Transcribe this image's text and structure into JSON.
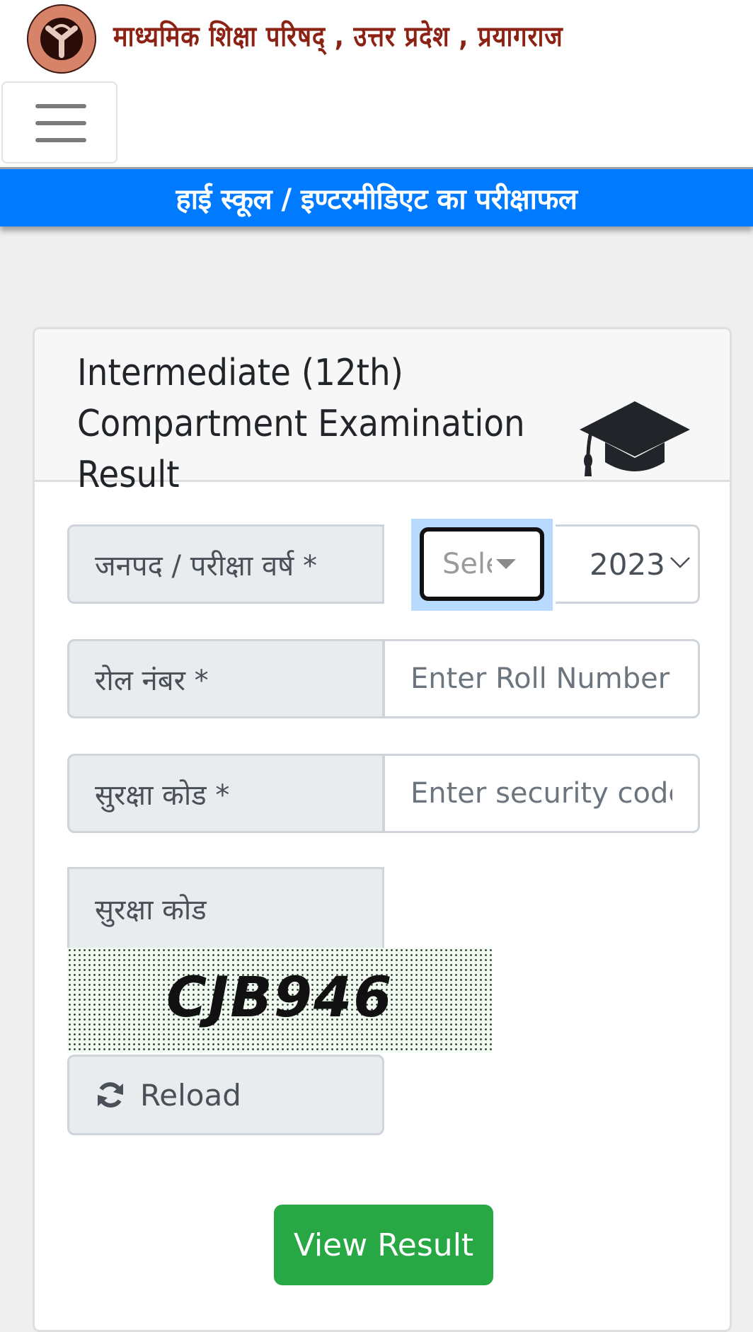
{
  "header": {
    "org_title": "माध्यमिक शिक्षा परिषद् , उत्तर प्रदेश , प्रयागराज",
    "logo_icon": "up-board-emblem-icon",
    "menu_icon": "hamburger-menu-icon"
  },
  "banner": {
    "title": "हाई स्कूल / इण्टरमीडिएट का परीक्षाफल",
    "color": "#007bff"
  },
  "card": {
    "title": "Intermediate (12th) Compartment Examination Result",
    "icon": "graduation-cap-icon"
  },
  "form": {
    "district_year": {
      "label": "जनपद / परीक्षा वर्ष *",
      "district_placeholder": "Sele",
      "year_value": "2023"
    },
    "roll_number": {
      "label": "रोल नंबर *",
      "placeholder": "Enter Roll Number"
    },
    "security_code": {
      "label": "सुरक्षा कोड *",
      "placeholder": "Enter security code"
    },
    "captcha": {
      "label": "सुरक्षा कोड",
      "code": "CJB946",
      "reload_label": "Reload",
      "reload_icon": "refresh-icon"
    },
    "submit_label": "View Result",
    "submit_color": "#28a745"
  }
}
